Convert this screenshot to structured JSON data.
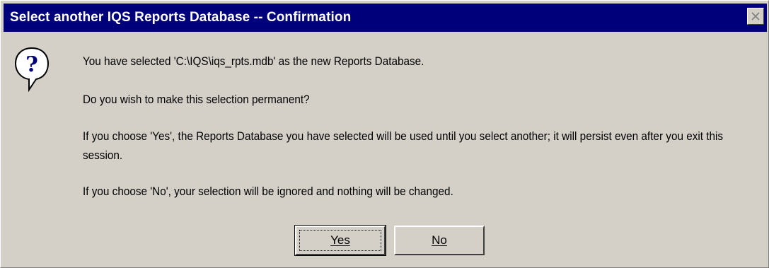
{
  "window": {
    "title": "Select another IQS Reports Database -- Confirmation",
    "close_icon": "close-icon"
  },
  "icon": "question-icon",
  "message": {
    "line1": "You have selected 'C:\\IQS\\iqs_rpts.mdb'  as the new Reports Database.",
    "line2": "Do you wish to make this selection permanent?",
    "line3": "If you choose 'Yes', the Reports Database you have selected will be used until you select another; it will persist even after you exit this session.",
    "line4": "If you choose 'No', your selection will be ignored and nothing will be changed."
  },
  "buttons": {
    "yes_label": "Yes",
    "no_label": "No"
  },
  "colors": {
    "titlebar": "#00007b",
    "dialog_bg": "#d4d0c8",
    "title_text": "#ffffff"
  }
}
